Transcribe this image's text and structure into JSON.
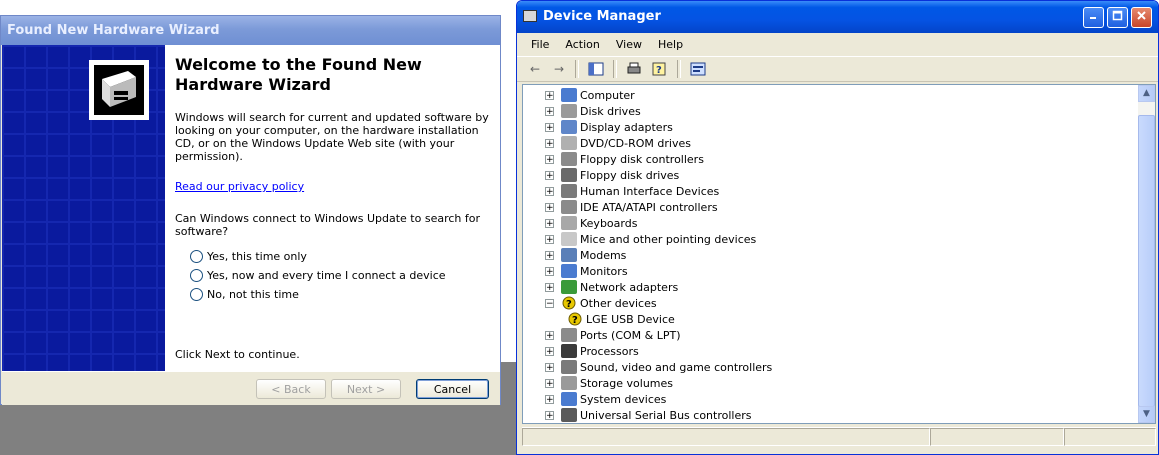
{
  "wizard": {
    "title": "Found New Hardware Wizard",
    "heading": "Welcome to the Found New Hardware Wizard",
    "intro": "Windows will search for current and updated software by looking on your computer, on the hardware installation CD, or on the Windows Update Web site (with your permission).",
    "privacy_link": "Read our privacy policy",
    "question": "Can Windows connect to Windows Update to search for software?",
    "options": [
      "Yes, this time only",
      "Yes, now and every time I connect a device",
      "No, not this time"
    ],
    "continue_text": "Click Next to continue.",
    "back_label": "< Back",
    "next_label": "Next >",
    "cancel_label": "Cancel"
  },
  "device_manager": {
    "title": "Device Manager",
    "menu": [
      "File",
      "Action",
      "View",
      "Help"
    ],
    "tree": [
      {
        "label": "Computer",
        "expanded": false,
        "icon": "computer-icon",
        "color": "#4a7bd0"
      },
      {
        "label": "Disk drives",
        "expanded": false,
        "icon": "disk-drive-icon",
        "color": "#9a9a9a"
      },
      {
        "label": "Display adapters",
        "expanded": false,
        "icon": "display-adapter-icon",
        "color": "#5f86c9"
      },
      {
        "label": "DVD/CD-ROM drives",
        "expanded": false,
        "icon": "dvd-drive-icon",
        "color": "#b0b0b0"
      },
      {
        "label": "Floppy disk controllers",
        "expanded": false,
        "icon": "floppy-controller-icon",
        "color": "#8b8b8b"
      },
      {
        "label": "Floppy disk drives",
        "expanded": false,
        "icon": "floppy-drive-icon",
        "color": "#6a6a6a"
      },
      {
        "label": "Human Interface Devices",
        "expanded": false,
        "icon": "hid-icon",
        "color": "#7a7a7a"
      },
      {
        "label": "IDE ATA/ATAPI controllers",
        "expanded": false,
        "icon": "ide-controller-icon",
        "color": "#8b8b8b"
      },
      {
        "label": "Keyboards",
        "expanded": false,
        "icon": "keyboard-icon",
        "color": "#a8a8a8"
      },
      {
        "label": "Mice and other pointing devices",
        "expanded": false,
        "icon": "mouse-icon",
        "color": "#c8c8c8"
      },
      {
        "label": "Modems",
        "expanded": false,
        "icon": "modem-icon",
        "color": "#5a7fb8"
      },
      {
        "label": "Monitors",
        "expanded": false,
        "icon": "monitor-icon",
        "color": "#4a7bd0"
      },
      {
        "label": "Network adapters",
        "expanded": false,
        "icon": "network-adapter-icon",
        "color": "#3a9a3a"
      },
      {
        "label": "Other devices",
        "expanded": true,
        "icon": "unknown-device-icon",
        "color": "#e8c800"
      },
      {
        "label": "LGE USB Device",
        "child": true,
        "icon": "warning-device-icon",
        "color": "#e8c800"
      },
      {
        "label": "Ports (COM & LPT)",
        "expanded": false,
        "icon": "port-icon",
        "color": "#8b8b8b"
      },
      {
        "label": "Processors",
        "expanded": false,
        "icon": "processor-icon",
        "color": "#3a3a3a"
      },
      {
        "label": "Sound, video and game controllers",
        "expanded": false,
        "icon": "sound-icon",
        "color": "#7a7a7a"
      },
      {
        "label": "Storage volumes",
        "expanded": false,
        "icon": "storage-volume-icon",
        "color": "#9a9a9a"
      },
      {
        "label": "System devices",
        "expanded": false,
        "icon": "system-device-icon",
        "color": "#4a7bd0"
      },
      {
        "label": "Universal Serial Bus controllers",
        "expanded": false,
        "icon": "usb-icon",
        "color": "#5a5a5a"
      }
    ]
  }
}
